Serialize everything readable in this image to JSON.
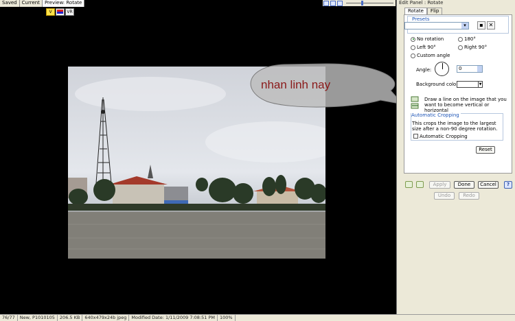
{
  "top_tabs": [
    "Saved",
    "Current",
    "Preview: Rotate"
  ],
  "mini_toolbar": [
    "V",
    "",
    "VR"
  ],
  "photo_overlay_text": "nhan linh nay",
  "status_bar": [
    "76/77",
    "New, P1010105",
    "206.5 KB",
    "640x479x24b jpeg",
    "Modified Date: 1/11/2009 7:08:51 PM",
    "100%"
  ],
  "panel": {
    "title": "Edit Panel : Rotate",
    "tabs": [
      "Rotate",
      "Flip"
    ],
    "presets_label": "Presets",
    "preset_value": "",
    "rotation_options": {
      "no_rotation": "No rotation",
      "r180": "180°",
      "left90": "Left 90°",
      "right90": "Right 90°",
      "custom": "Custom angle"
    },
    "selected_rotation": "No rotation",
    "angle_label": "Angle:",
    "angle_value": "0",
    "bg_color_label": "Background color:",
    "bg_color": "#ffffff",
    "line_hint": "Draw a line on the image that you want to become vertical or horizontal",
    "auto_crop_title": "Automatic Cropping",
    "auto_crop_desc": "This crops the image to the largest size after a non-90 degree rotation.",
    "auto_crop_checkbox": "Automatic Cropping",
    "auto_crop_checked": false,
    "reset": "Reset",
    "apply": "Apply",
    "done": "Done",
    "cancel": "Cancel",
    "undo": "Undo",
    "redo": "Redo",
    "help": "?"
  },
  "colors": {
    "overlay_text": "#8a1919",
    "group_title": "#1b53b6",
    "panel_bg": "#ece9d8"
  }
}
